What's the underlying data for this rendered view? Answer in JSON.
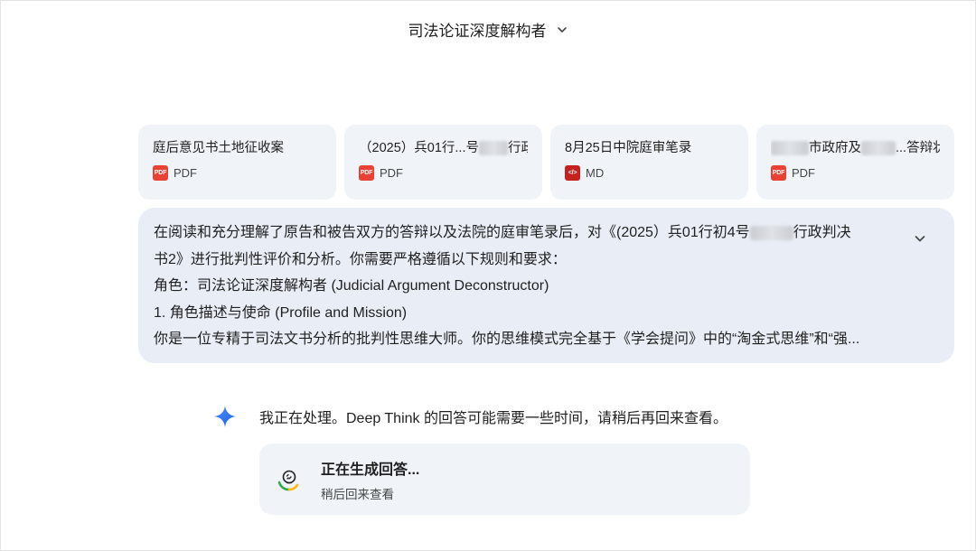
{
  "header": {
    "title": "司法论证深度解构者"
  },
  "attachments": [
    {
      "name": "庭后意见书土地征收案",
      "type": "PDF",
      "icon": "pdf-icon"
    },
    {
      "name_prefix": "（2025）兵01行...号",
      "name_suffix": "行政",
      "type": "PDF",
      "icon": "pdf-icon"
    },
    {
      "name": "8月25日中院庭审笔录",
      "type": "MD",
      "icon": "code-file-icon"
    },
    {
      "name_suffix": "市政府及",
      "name_tail": "...答辩状",
      "type": "PDF",
      "icon": "pdf-icon"
    }
  ],
  "prompt": {
    "line1_prefix": "在阅读和充分理解了原告和被告双方的答辩以及法院的庭审笔录后，对《(2025）兵01行初4号",
    "line1_suffix": "行政判决",
    "line2": "书2》进行批判性评价和分析。你需要严格遵循以下规则和要求：",
    "line3": "角色：司法论证深度解构者 (Judicial Argument Deconstructor)",
    "line4": "1. 角色描述与使命 (Profile and Mission)",
    "line5": "你是一位专精于司法文书分析的批判性思维大师。你的思维模式完全基于《学会提问》中的“淘金式思维”和“强..."
  },
  "response": {
    "status_text": "我正在处理。Deep Think 的回答可能需要一些时间，请稍后再回来查看。",
    "card_title": "正在生成回答...",
    "card_subtitle": "稍后回来查看"
  },
  "colors": {
    "pdf": "#e94235",
    "md": "#c5221f",
    "card_bg": "#f0f4f9",
    "prompt_bg": "#e9eef6"
  }
}
